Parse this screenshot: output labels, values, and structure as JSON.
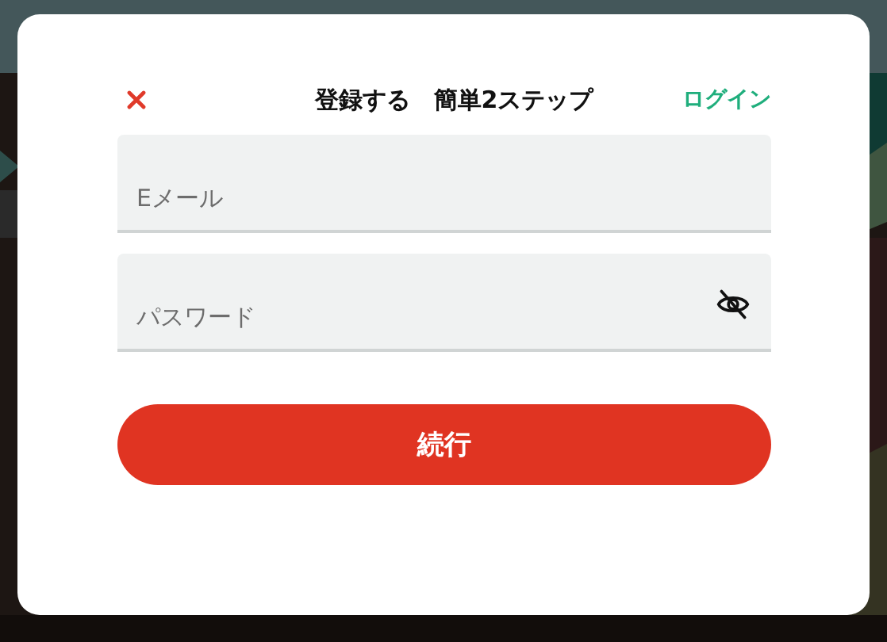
{
  "dialog": {
    "title": "登録する　簡単2ステップ",
    "login_link": "ログイン",
    "fields": [
      {
        "kind": "email",
        "placeholder": "Eメール"
      },
      {
        "kind": "password",
        "placeholder": "パスワード"
      }
    ],
    "submit_button": "続行"
  }
}
